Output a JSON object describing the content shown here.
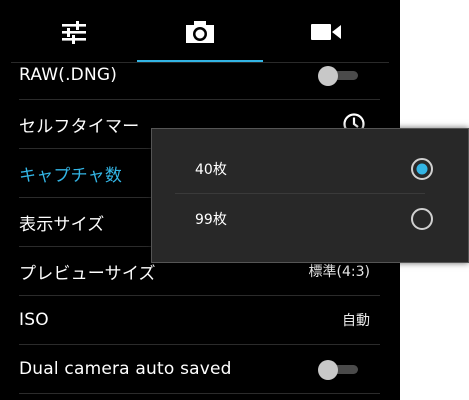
{
  "tabs": [
    {
      "icon": "sliders-icon",
      "selected": false
    },
    {
      "icon": "camera-icon",
      "selected": true
    },
    {
      "icon": "video-camera-icon",
      "selected": false
    }
  ],
  "settings": {
    "raw": {
      "label": "RAW(.DNG)",
      "enabled": false
    },
    "self_timer": {
      "label": "セルフタイマー",
      "icon": "clock-icon"
    },
    "capture_count": {
      "label": "キャプチャ数"
    },
    "display_size": {
      "label": "表示サイズ"
    },
    "preview_size": {
      "label": "プレビューサイズ",
      "value": "標準(4:3)"
    },
    "iso": {
      "label": "ISO",
      "value": "自動"
    },
    "dual_camera": {
      "label": "Dual camera auto saved",
      "enabled": false
    }
  },
  "popup": {
    "options": [
      {
        "label": "40枚",
        "selected": true
      },
      {
        "label": "99枚",
        "selected": false
      }
    ]
  },
  "colors": {
    "accent": "#33b5e5",
    "background": "#000000",
    "popup_bg": "#282828"
  }
}
